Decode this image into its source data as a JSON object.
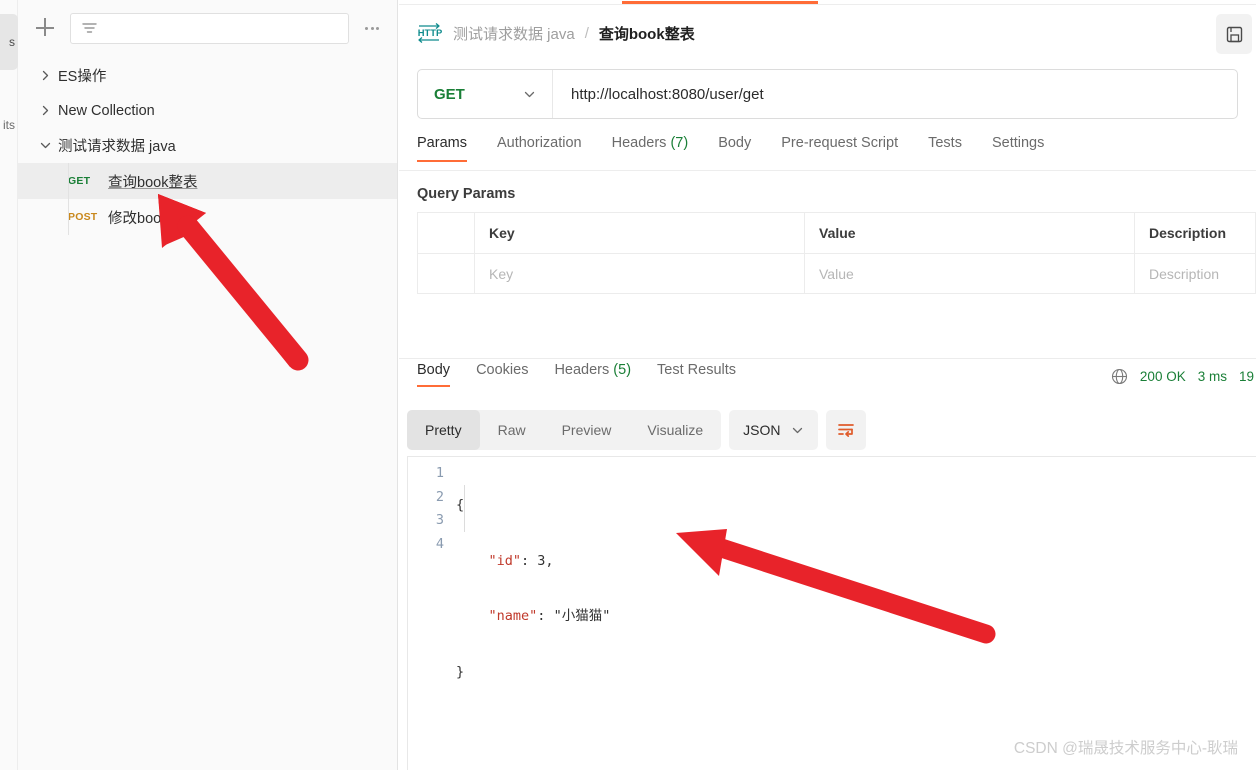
{
  "rail": {
    "items": [
      {
        "name": "collections",
        "label": "s",
        "active": true
      },
      {
        "name": "environments",
        "label": "its",
        "active": false
      }
    ]
  },
  "sidebar": {
    "new_button": "+",
    "search": {
      "placeholder": "",
      "value": ""
    },
    "more_menu": "•••",
    "tree": [
      {
        "label": "ES操作",
        "expanded": false,
        "type": "collection"
      },
      {
        "label": "New Collection",
        "expanded": false,
        "type": "collection"
      },
      {
        "label": "测试请求数据 java",
        "expanded": true,
        "type": "collection"
      }
    ],
    "requests": [
      {
        "method": "GET",
        "label": "查询book整表",
        "selected": true
      },
      {
        "method": "POST",
        "label": "修改book数据",
        "selected": false
      }
    ]
  },
  "header": {
    "icon": "http-icon",
    "collection": "测试请求数据 java",
    "separator": "/",
    "request_name": "查询book整表",
    "save_layout_icon": "save-icon"
  },
  "request": {
    "method": "GET",
    "url": "http://localhost:8080/user/get",
    "tabs": [
      {
        "label": "Params",
        "count": "",
        "active": true
      },
      {
        "label": "Authorization",
        "count": "",
        "active": false
      },
      {
        "label": "Headers",
        "count": "(7)",
        "active": false
      },
      {
        "label": "Body",
        "count": "",
        "active": false
      },
      {
        "label": "Pre-request Script",
        "count": "",
        "active": false
      },
      {
        "label": "Tests",
        "count": "",
        "active": false
      },
      {
        "label": "Settings",
        "count": "",
        "active": false
      }
    ],
    "query_params_title": "Query Params",
    "table": {
      "headers": [
        "Key",
        "Value",
        "Description"
      ],
      "rows": [
        {
          "key": "Key",
          "value": "Value",
          "description": "Description"
        }
      ]
    }
  },
  "response": {
    "tabs": [
      {
        "label": "Body",
        "count": "",
        "active": true
      },
      {
        "label": "Cookies",
        "count": "",
        "active": false
      },
      {
        "label": "Headers",
        "count": "(5)",
        "active": false
      },
      {
        "label": "Test Results",
        "count": "",
        "active": false
      }
    ],
    "status": "200 OK",
    "time": "3 ms",
    "size": "19",
    "view_modes": [
      {
        "label": "Pretty",
        "active": true
      },
      {
        "label": "Raw",
        "active": false
      },
      {
        "label": "Preview",
        "active": false
      },
      {
        "label": "Visualize",
        "active": false
      }
    ],
    "format": "JSON",
    "wrap_icon": "wrap-lines-icon",
    "body_lines": [
      {
        "n": "1",
        "text": "{"
      },
      {
        "n": "2",
        "text": "    \"id\": 3,"
      },
      {
        "n": "3",
        "text": "    \"name\": \"小猫猫\""
      },
      {
        "n": "4",
        "text": "}"
      }
    ],
    "json": {
      "id": 3,
      "name": "小猫猫"
    }
  },
  "annotations": {
    "arrow_color": "#e8232a",
    "arrow_1": "points at sidebar request 查询book整表",
    "arrow_2": "points at response body json"
  },
  "watermark": "CSDN @瑞晟技术服务中心-耿瑞",
  "colors": {
    "accent": "#ff6c37",
    "get_green": "#1a7f37",
    "post_orange": "#c9881c",
    "arrow_red": "#e8232a"
  }
}
